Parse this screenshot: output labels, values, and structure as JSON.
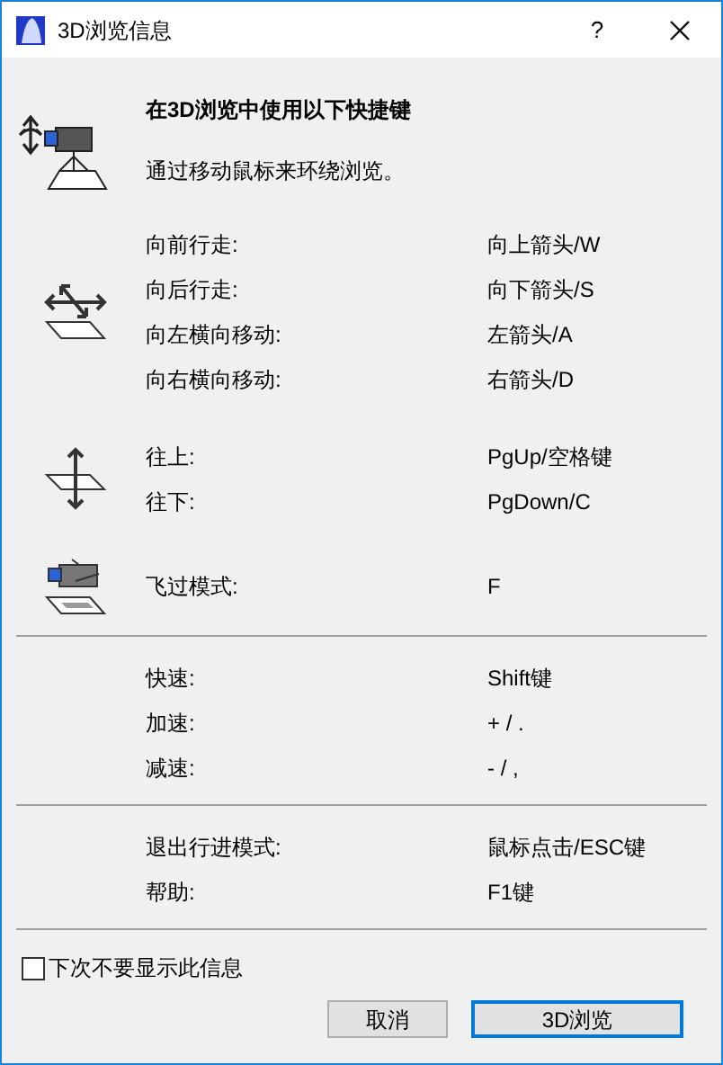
{
  "window": {
    "title": "3D浏览信息",
    "help": "?"
  },
  "intro": {
    "title": "在3D浏览中使用以下快捷键",
    "text": "通过移动鼠标来环绕浏览。"
  },
  "sections": [
    {
      "groups": [
        {
          "kind": "walk",
          "rows": [
            {
              "label": "向前行走:",
              "value": "向上箭头/W"
            },
            {
              "label": "向后行走:",
              "value": "向下箭头/S"
            },
            {
              "label": "向左横向移动:",
              "value": "左箭头/A"
            },
            {
              "label": "向右横向移动:",
              "value": "右箭头/D"
            }
          ]
        },
        {
          "kind": "updown",
          "rows": [
            {
              "label": "往上:",
              "value": "PgUp/空格键"
            },
            {
              "label": "往下:",
              "value": "PgDown/C"
            }
          ]
        },
        {
          "kind": "fly",
          "rows": [
            {
              "label": "飞过模式:",
              "value": "F"
            }
          ]
        }
      ]
    },
    {
      "groups": [
        {
          "kind": "plain",
          "rows": [
            {
              "label": "快速:",
              "value": "Shift键"
            },
            {
              "label": "加速:",
              "value": "+ / ."
            },
            {
              "label": "减速:",
              "value": "- / ,"
            }
          ]
        }
      ]
    },
    {
      "groups": [
        {
          "kind": "plain",
          "rows": [
            {
              "label": "退出行进模式:",
              "value": "鼠标点击/ESC键"
            },
            {
              "label": "帮助:",
              "value": "F1键"
            }
          ]
        }
      ]
    }
  ],
  "checkbox": {
    "label": "下次不要显示此信息",
    "checked": false
  },
  "buttons": [
    {
      "label": "取消",
      "default": false
    },
    {
      "label": "3D浏览",
      "default": true
    }
  ]
}
